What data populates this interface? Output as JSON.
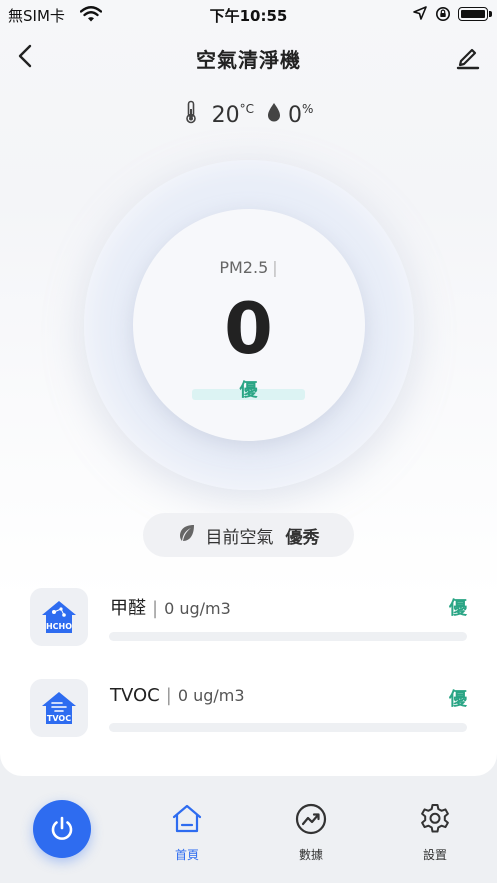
{
  "status_bar": {
    "carrier": "無SIM卡",
    "time": "下午10:55"
  },
  "nav": {
    "title": "空氣清淨機"
  },
  "environment": {
    "temperature": "20",
    "temperature_unit": "°C",
    "humidity": "0",
    "humidity_unit": "%"
  },
  "pm25": {
    "label": "PM2.5",
    "separator": "|",
    "value": "0",
    "quality": "優"
  },
  "air_status": {
    "label": "目前空氣",
    "value": "優秀"
  },
  "metrics": [
    {
      "name": "甲醛",
      "value": "0 ug/m3",
      "quality": "優",
      "icon_text": "HCHO",
      "level": 0
    },
    {
      "name": "TVOC",
      "value": "0 ug/m3",
      "quality": "優",
      "icon_text": "TVOC",
      "level": 0
    }
  ],
  "tabs": [
    {
      "label": "首頁",
      "active": true
    },
    {
      "label": "數據",
      "active": false
    },
    {
      "label": "設置",
      "active": false
    }
  ],
  "colors": {
    "accent": "#2e6cf0",
    "good": "#2aa585"
  }
}
